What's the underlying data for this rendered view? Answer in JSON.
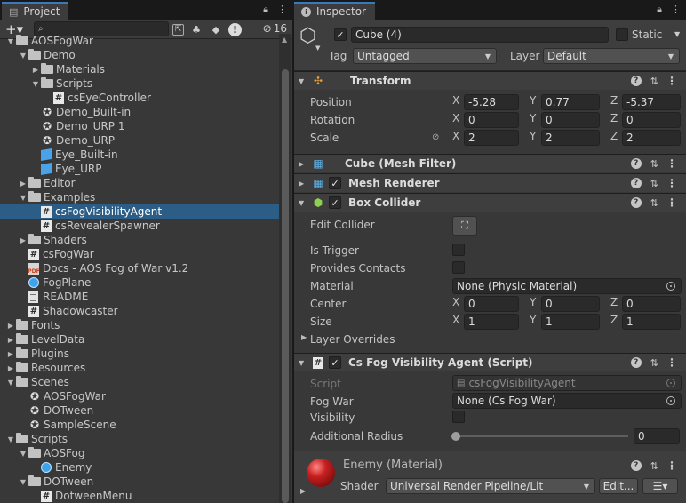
{
  "project": {
    "tab_label": "Project",
    "search": {
      "placeholder": "",
      "value": ""
    },
    "hidden_count": "16",
    "tree": [
      {
        "indent": 1,
        "arrow": "open",
        "icon": "folder",
        "label": "AOSFogWar"
      },
      {
        "indent": 2,
        "arrow": "open",
        "icon": "folder",
        "label": "Demo"
      },
      {
        "indent": 3,
        "arrow": "closed",
        "icon": "folder",
        "label": "Materials"
      },
      {
        "indent": 3,
        "arrow": "open",
        "icon": "folder",
        "label": "Scripts"
      },
      {
        "indent": 4,
        "arrow": "none",
        "icon": "script",
        "label": "csEyeController"
      },
      {
        "indent": 3,
        "arrow": "none",
        "icon": "scene",
        "label": "Demo_Built-in"
      },
      {
        "indent": 3,
        "arrow": "none",
        "icon": "scene",
        "label": "Demo_URP 1"
      },
      {
        "indent": 3,
        "arrow": "none",
        "icon": "scene",
        "label": "Demo_URP"
      },
      {
        "indent": 3,
        "arrow": "none",
        "icon": "prefab",
        "label": "Eye_Built-in"
      },
      {
        "indent": 3,
        "arrow": "none",
        "icon": "prefab",
        "label": "Eye_URP"
      },
      {
        "indent": 2,
        "arrow": "closed",
        "icon": "folder",
        "label": "Editor"
      },
      {
        "indent": 2,
        "arrow": "open",
        "icon": "folder",
        "label": "Examples"
      },
      {
        "indent": 3,
        "arrow": "none",
        "icon": "script",
        "label": "csFogVisibilityAgent",
        "selected": true
      },
      {
        "indent": 3,
        "arrow": "none",
        "icon": "script",
        "label": "csRevealerSpawner"
      },
      {
        "indent": 2,
        "arrow": "closed",
        "icon": "folder",
        "label": "Shaders"
      },
      {
        "indent": 2,
        "arrow": "none",
        "icon": "script",
        "label": "csFogWar"
      },
      {
        "indent": 2,
        "arrow": "none",
        "icon": "pdf",
        "label": "Docs - AOS Fog of War v1.2"
      },
      {
        "indent": 2,
        "arrow": "none",
        "icon": "material",
        "label": "FogPlane"
      },
      {
        "indent": 2,
        "arrow": "none",
        "icon": "text",
        "label": "README"
      },
      {
        "indent": 2,
        "arrow": "none",
        "icon": "script",
        "label": "Shadowcaster"
      },
      {
        "indent": 1,
        "arrow": "closed",
        "icon": "folder",
        "label": "Fonts"
      },
      {
        "indent": 1,
        "arrow": "closed",
        "icon": "folder",
        "label": "LevelData"
      },
      {
        "indent": 1,
        "arrow": "closed",
        "icon": "folder",
        "label": "Plugins"
      },
      {
        "indent": 1,
        "arrow": "closed",
        "icon": "folder",
        "label": "Resources"
      },
      {
        "indent": 1,
        "arrow": "open",
        "icon": "folder",
        "label": "Scenes"
      },
      {
        "indent": 2,
        "arrow": "none",
        "icon": "scene",
        "label": "AOSFogWar"
      },
      {
        "indent": 2,
        "arrow": "none",
        "icon": "scene",
        "label": "DOTween"
      },
      {
        "indent": 2,
        "arrow": "none",
        "icon": "scene",
        "label": "SampleScene"
      },
      {
        "indent": 1,
        "arrow": "open",
        "icon": "folder",
        "label": "Scripts"
      },
      {
        "indent": 2,
        "arrow": "open",
        "icon": "folder",
        "label": "AOSFog"
      },
      {
        "indent": 3,
        "arrow": "none",
        "icon": "material",
        "label": "Enemy"
      },
      {
        "indent": 2,
        "arrow": "open",
        "icon": "folder",
        "label": "DOTween"
      },
      {
        "indent": 3,
        "arrow": "none",
        "icon": "script",
        "label": "DotweenMenu"
      }
    ]
  },
  "inspector": {
    "tab_label": "Inspector",
    "object": {
      "name": "Cube (4)",
      "static_label": "Static",
      "tag_label": "Tag",
      "tag_value": "Untagged",
      "layer_label": "Layer",
      "layer_value": "Default"
    },
    "transform": {
      "title": "Transform",
      "position_label": "Position",
      "position": {
        "x": "-5.28",
        "y": "0.77",
        "z": "-5.37"
      },
      "rotation_label": "Rotation",
      "rotation": {
        "x": "0",
        "y": "0",
        "z": "0"
      },
      "scale_label": "Scale",
      "scale": {
        "x": "2",
        "y": "2",
        "z": "2"
      }
    },
    "mesh_filter": {
      "title": "Cube (Mesh Filter)"
    },
    "mesh_renderer": {
      "title": "Mesh Renderer"
    },
    "box_collider": {
      "title": "Box Collider",
      "edit_collider_label": "Edit Collider",
      "is_trigger_label": "Is Trigger",
      "provides_contacts_label": "Provides Contacts",
      "material_label": "Material",
      "material_value": "None (Physic Material)",
      "center_label": "Center",
      "center": {
        "x": "0",
        "y": "0",
        "z": "0"
      },
      "size_label": "Size",
      "size": {
        "x": "1",
        "y": "1",
        "z": "1"
      },
      "layer_overrides_label": "Layer Overrides"
    },
    "agent": {
      "title": "Cs Fog Visibility Agent (Script)",
      "script_label": "Script",
      "script_value": "csFogVisibilityAgent",
      "fogwar_label": "Fog War",
      "fogwar_value": "None (Cs Fog War)",
      "visibility_label": "Visibility",
      "radius_label": "Additional Radius",
      "radius_value": "0"
    },
    "material": {
      "title": "Enemy (Material)",
      "shader_label": "Shader",
      "shader_value": "Universal Render Pipeline/Lit",
      "edit_label": "Edit..."
    },
    "axis": {
      "x": "X",
      "y": "Y",
      "z": "Z"
    }
  }
}
